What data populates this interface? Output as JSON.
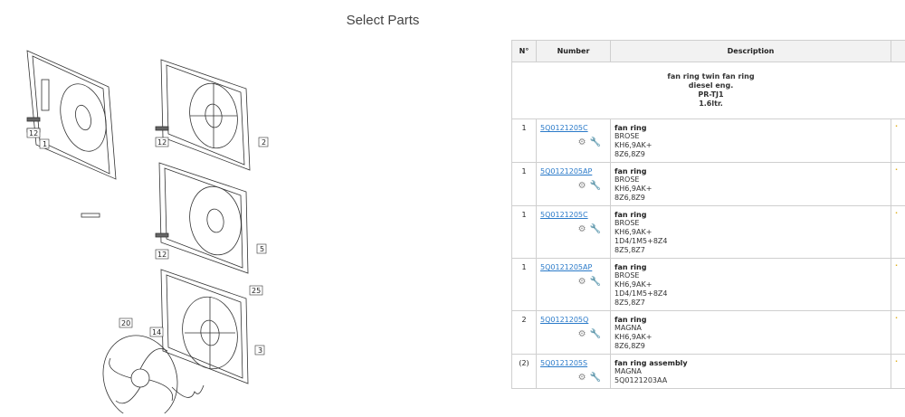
{
  "page_title": "Select Parts",
  "diagram": {
    "callouts": [
      "12",
      "1",
      "12",
      "2",
      "12",
      "5",
      "25",
      "20",
      "14",
      "3"
    ]
  },
  "table": {
    "headers": [
      "N°",
      "Number",
      "Description"
    ],
    "group": {
      "line1": "fan ring twin fan ring",
      "line2": "diesel eng.",
      "line3": "PR-TJ1",
      "line4": "1.6ltr."
    },
    "rows": [
      {
        "n": "1",
        "number": "5Q0121205C",
        "title": "fan ring",
        "lines": [
          "BROSE",
          "KH6,9AK+",
          "8Z6,8Z9"
        ]
      },
      {
        "n": "1",
        "number": "5Q0121205AP",
        "title": "fan ring",
        "lines": [
          "BROSE",
          "KH6,9AK+",
          "8Z6,8Z9"
        ]
      },
      {
        "n": "1",
        "number": "5Q0121205C",
        "title": "fan ring",
        "lines": [
          "BROSE",
          "KH6,9AK+",
          "1D4/1M5+8Z4",
          "8Z5,8Z7"
        ]
      },
      {
        "n": "1",
        "number": "5Q0121205AP",
        "title": "fan ring",
        "lines": [
          "BROSE",
          "KH6,9AK+",
          "1D4/1M5+8Z4",
          "8Z5,8Z7"
        ]
      },
      {
        "n": "2",
        "number": "5Q0121205Q",
        "title": "fan ring",
        "lines": [
          "MAGNA",
          "KH6,9AK+",
          "8Z6,8Z9"
        ]
      },
      {
        "n": "(2)",
        "number": "5Q0121205S",
        "title": "fan ring assembly",
        "lines": [
          "MAGNA",
          "5Q0121203AA"
        ]
      }
    ]
  },
  "icons": {
    "gear": "gear-icon",
    "wrench": "wrench-icon"
  },
  "colors": {
    "link": "#2a7ac9",
    "header_bg": "#f2f2f2",
    "marker": "#e0b020"
  }
}
